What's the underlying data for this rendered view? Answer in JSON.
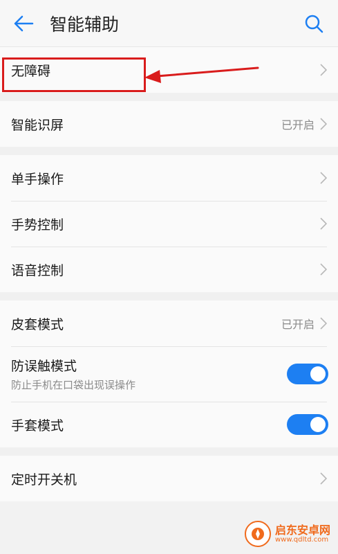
{
  "header": {
    "title": "智能辅助"
  },
  "groups": [
    {
      "items": [
        {
          "label": "无障碍"
        }
      ]
    },
    {
      "items": [
        {
          "label": "智能识屏",
          "value": "已开启"
        }
      ]
    },
    {
      "items": [
        {
          "label": "单手操作"
        },
        {
          "label": "手势控制"
        },
        {
          "label": "语音控制"
        }
      ]
    },
    {
      "items": [
        {
          "label": "皮套模式",
          "value": "已开启"
        },
        {
          "label": "防误触模式",
          "sub": "防止手机在口袋出现误操作",
          "toggle": true
        },
        {
          "label": "手套模式",
          "toggle": true
        }
      ]
    },
    {
      "items": [
        {
          "label": "定时开关机"
        }
      ]
    }
  ],
  "watermark": {
    "title": "启东安卓网",
    "url": "www.qdltd.com"
  },
  "colors": {
    "accent": "#1d7ff2",
    "annotation": "#d91c1c",
    "watermark": "#f06a1c"
  }
}
